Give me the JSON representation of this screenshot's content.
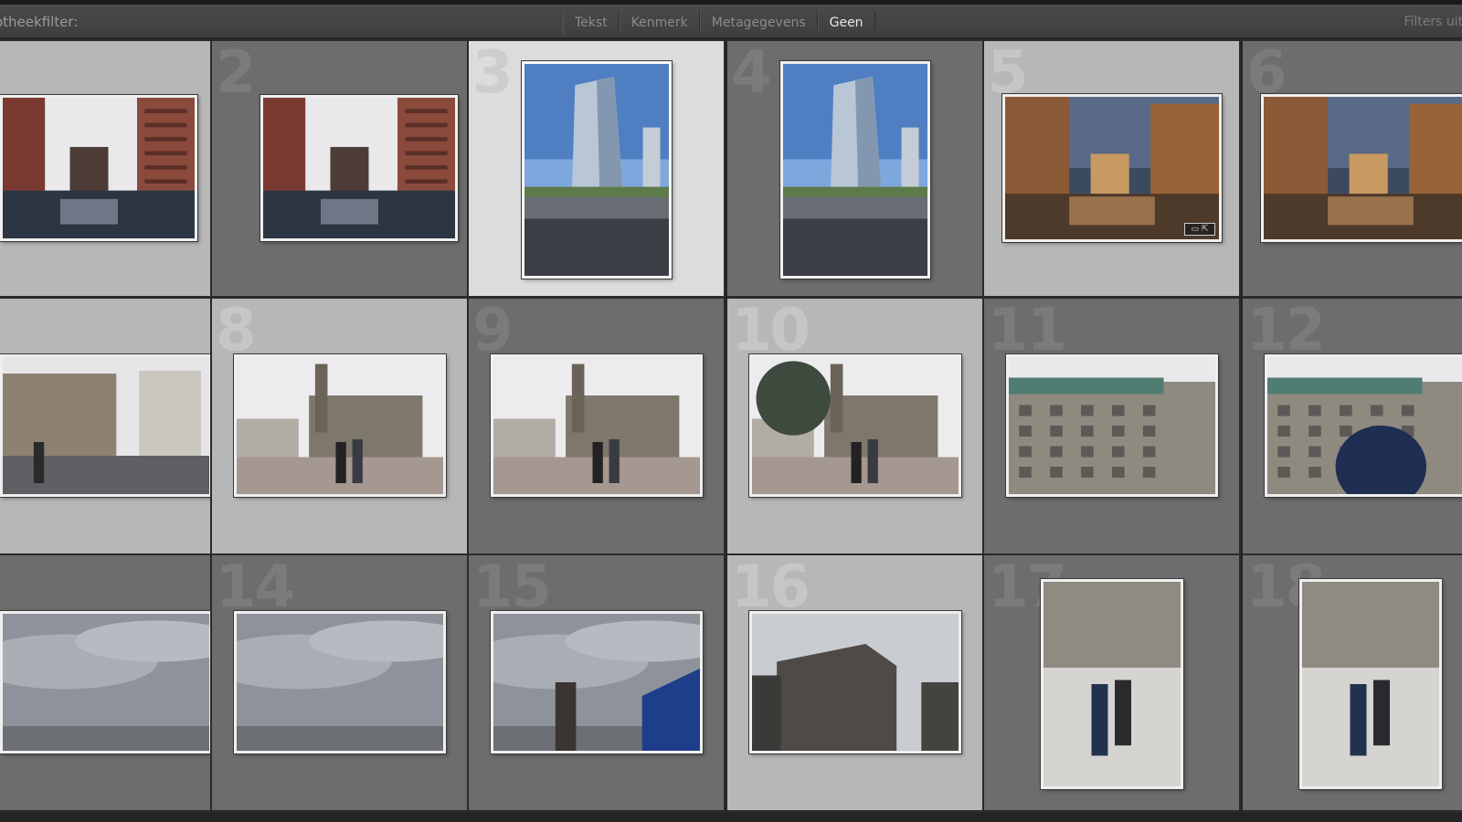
{
  "filter_bar": {
    "title": "otheekfilter:",
    "tabs": [
      {
        "label": "Tekst",
        "active": false
      },
      {
        "label": "Kenmerk",
        "active": false
      },
      {
        "label": "Metagegevens",
        "active": false
      },
      {
        "label": "Geen",
        "active": true
      }
    ],
    "right_label": "Filters uitg"
  },
  "grid": {
    "cells": [
      {
        "number": "",
        "shade": "light",
        "scene": "canal-red"
      },
      {
        "number": "2",
        "shade": "dark",
        "scene": "canal-red"
      },
      {
        "number": "3",
        "shade": "selected",
        "scene": "tower-portrait"
      },
      {
        "number": "4",
        "shade": "dark",
        "scene": "tower-portrait-2"
      },
      {
        "number": "5",
        "shade": "light",
        "scene": "canal-golden",
        "badge": "▭ ⇱"
      },
      {
        "number": "6",
        "shade": "dark",
        "scene": "canal-golden-2"
      },
      {
        "number": "",
        "shade": "light",
        "scene": "street-buildings"
      },
      {
        "number": "8",
        "shade": "light",
        "scene": "town-hall-square"
      },
      {
        "number": "9",
        "shade": "dark",
        "scene": "square-people"
      },
      {
        "number": "10",
        "shade": "light",
        "scene": "square-trees"
      },
      {
        "number": "11",
        "shade": "dark",
        "scene": "town-hall-facade"
      },
      {
        "number": "12",
        "shade": "dark",
        "scene": "town-hall-umbrella"
      },
      {
        "number": "3",
        "shade": "dark",
        "scene": "cloudy-sky"
      },
      {
        "number": "14",
        "shade": "dark",
        "scene": "cloudy-sky-2"
      },
      {
        "number": "15",
        "shade": "dark",
        "scene": "cloudy-sky-3"
      },
      {
        "number": "16",
        "shade": "light",
        "scene": "building-wide"
      },
      {
        "number": "17",
        "shade": "dark",
        "scene": "walkers-portrait"
      },
      {
        "number": "18",
        "shade": "dark",
        "scene": "walkers-portrait-2"
      }
    ]
  },
  "colors": {
    "cell_dark": "#6d6d6d",
    "cell_light": "#b7b7b7",
    "cell_selected": "#dcdcdc",
    "filter_active": "#e8e8e8"
  }
}
